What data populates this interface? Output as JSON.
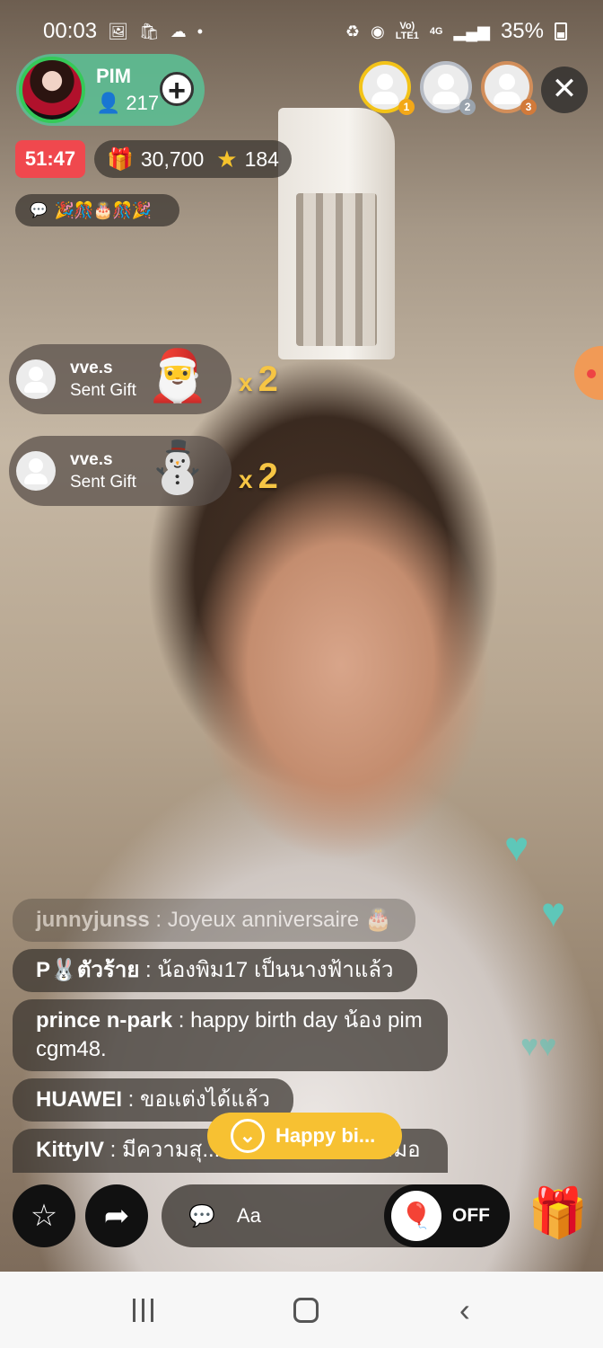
{
  "status_bar": {
    "time": "00:03",
    "left_icons": [
      "image-icon",
      "shop-icon",
      "cloud-icon",
      "dot-icon"
    ],
    "network_top": "Vo)",
    "network_bottom": "LTE1",
    "signal_label": "4G",
    "battery": "35%"
  },
  "host": {
    "name": "PIM",
    "viewers": "217",
    "follow_symbol": "+"
  },
  "top_fans": [
    {
      "rank": "1",
      "tier": "gold"
    },
    {
      "rank": "2",
      "tier": "silver"
    },
    {
      "rank": "3",
      "tier": "bronze"
    }
  ],
  "close_symbol": "✕",
  "live_timer": "51:47",
  "stats": {
    "gifts": "30,700",
    "stars": "184"
  },
  "pinned_message": {
    "emojis": "🎉🎊🎂🎊🎉"
  },
  "gift_notifications": [
    {
      "user": "vve.s",
      "action": "Sent Gift",
      "sticker": "🎅",
      "multiplier": "x",
      "count": "2"
    },
    {
      "user": "vve.s",
      "action": "Sent Gift",
      "sticker": "⛄",
      "multiplier": "x",
      "count": "2"
    }
  ],
  "chat": [
    {
      "user": "junnyjunss",
      "sep": " : ",
      "text": "Joyeux anniversaire 🎂",
      "faded": true
    },
    {
      "user": "P🐰ตัวร้าย",
      "sep": " : ",
      "text": "น้องพิม17 เป็นนางฟ้าแล้ว",
      "faded": false
    },
    {
      "user": "prince  n-park",
      "sep": " : ",
      "text": "happy birth day น้อง pim  cgm48.",
      "faded": false
    },
    {
      "user": "HUAWEI",
      "sep": " : ",
      "text": "ขอแต่งได้แล้ว",
      "faded": false
    },
    {
      "user": "KittyIV",
      "sep": " : ",
      "text": "มีความสุ...ม เป็นกำลังใจให้เสมอเยย",
      "faded": false
    }
  ],
  "new_message_button": {
    "label": "Happy bi...",
    "icon": "chevron-down-icon"
  },
  "toolbar": {
    "comment_placeholder": "Aa",
    "balloon_state": "OFF"
  },
  "colors": {
    "timer": "#f0484e",
    "host_pill": "#5cbe94",
    "new_message": "#f7c132",
    "gift_count": "#f6c544",
    "heart": "#5ec7b9"
  }
}
